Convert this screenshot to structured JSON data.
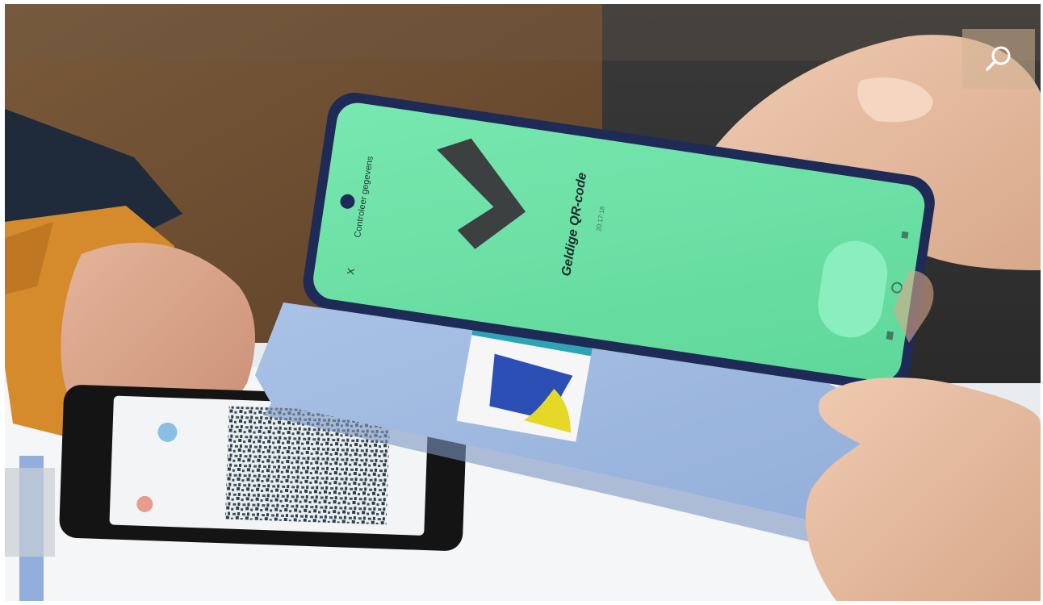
{
  "photo": {
    "phone_screen": {
      "header": "Controleer gegevens",
      "status": "Geldige QR-code",
      "status_time": "20:17:18",
      "close_symbol": "X",
      "screen_color": "#6ee3a7",
      "checkmark_color": "#3c4040"
    },
    "background_phone": {
      "shows": "QR code on screen"
    },
    "folio_card": {
      "colors": [
        "#2b4fb5",
        "#e6d826",
        "#f6f6f6"
      ]
    }
  },
  "overlay": {
    "icon": "search-icon"
  }
}
